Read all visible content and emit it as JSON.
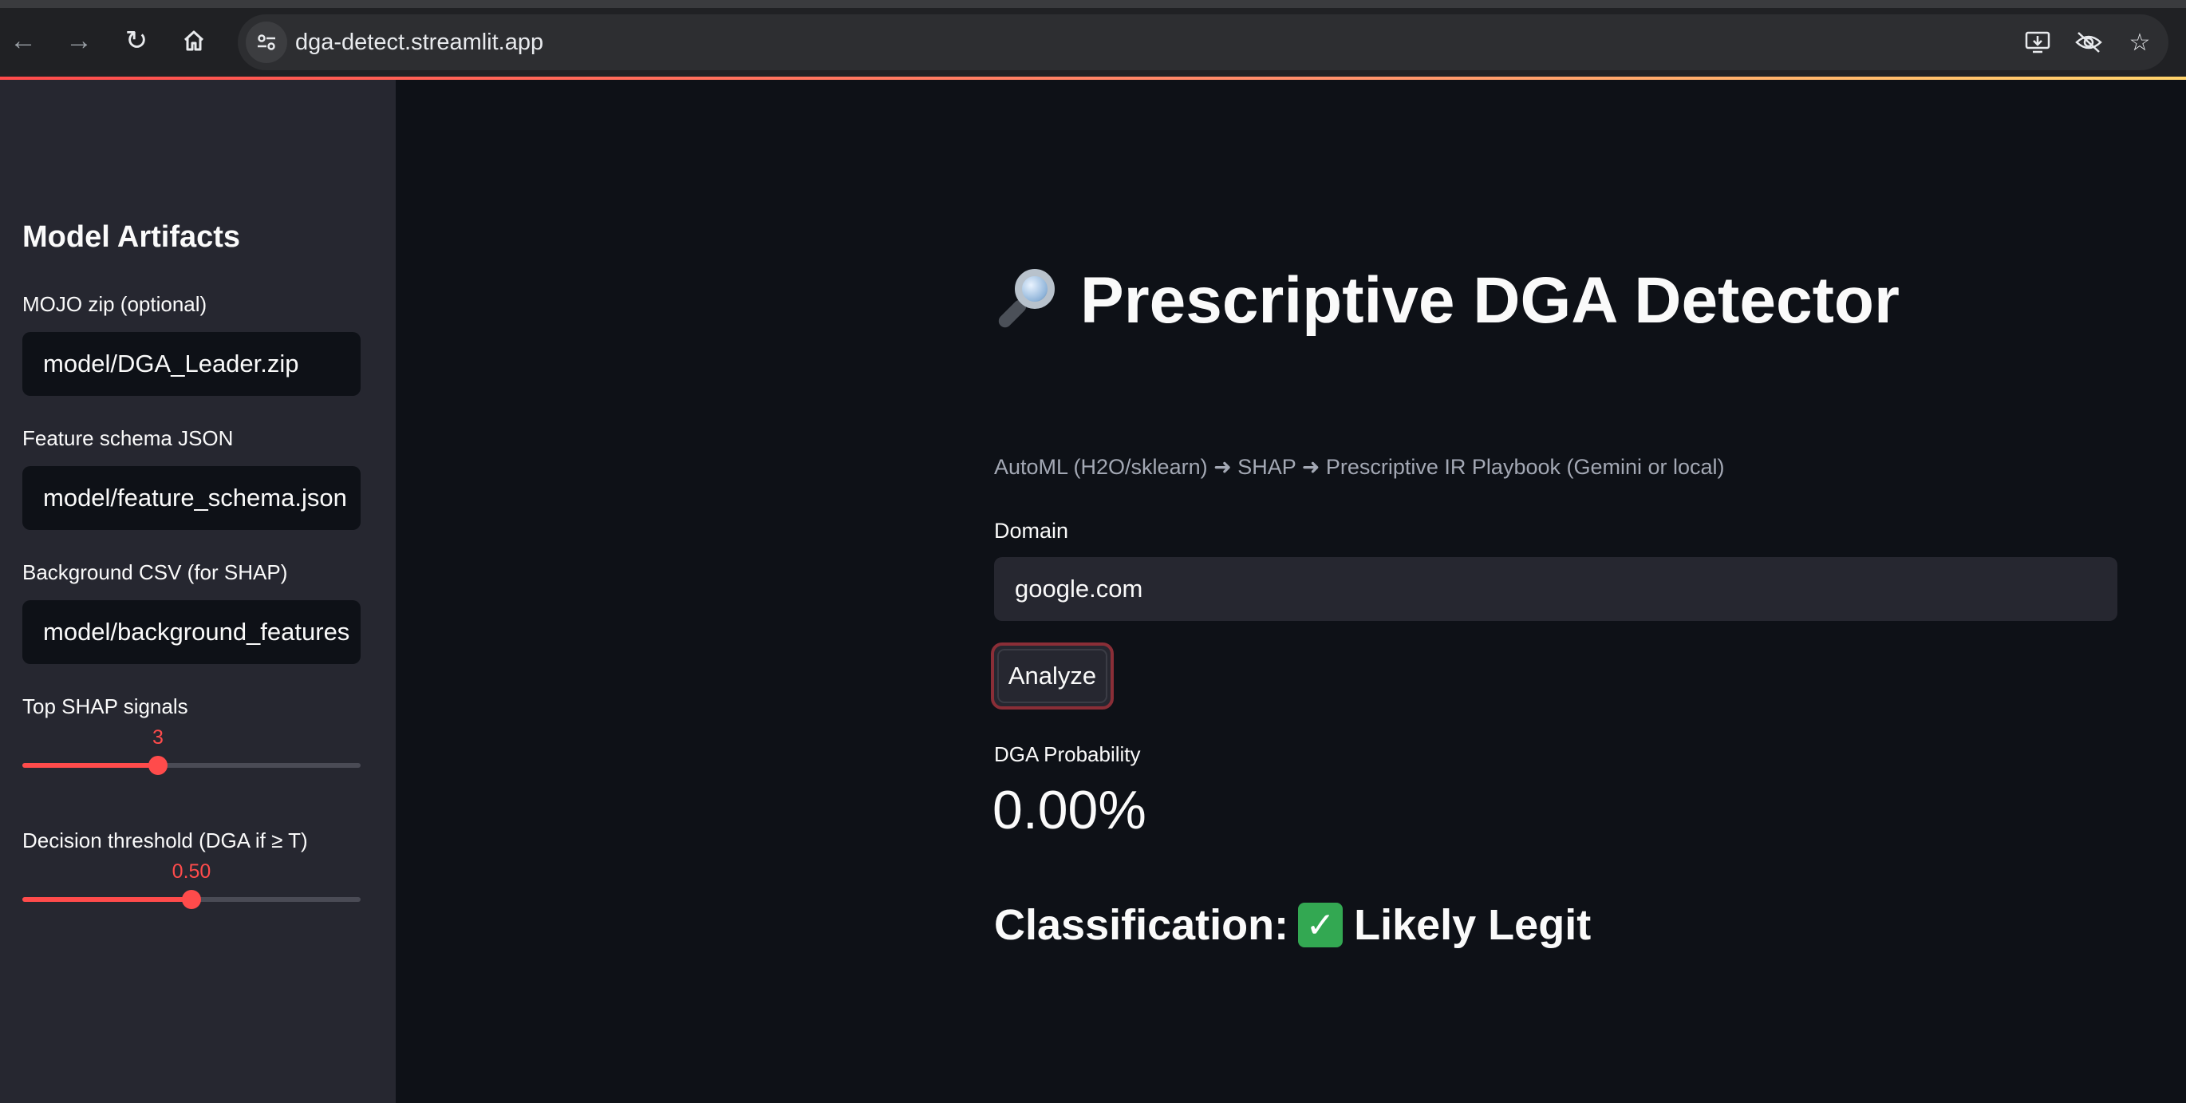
{
  "browser": {
    "url": "dga-detect.streamlit.app"
  },
  "sidebar": {
    "heading": "Model Artifacts",
    "mojo": {
      "label": "MOJO zip (optional)",
      "value": "model/DGA_Leader.zip"
    },
    "schema": {
      "label": "Feature schema JSON",
      "value": "model/feature_schema.json"
    },
    "background": {
      "label": "Background CSV (for SHAP)",
      "value": "model/background_features"
    },
    "top_shap": {
      "label": "Top SHAP signals",
      "value": "3",
      "fraction": 0.4
    },
    "threshold": {
      "label": "Decision threshold (DGA if ≥ T)",
      "value": "0.50",
      "fraction": 0.5
    }
  },
  "main": {
    "title": "Prescriptive DGA Detector",
    "title_icon": "magnifier-icon",
    "subtitle": "AutoML (H2O/sklearn) ➜ SHAP ➜ Prescriptive IR Playbook (Gemini or local)",
    "domain_label": "Domain",
    "domain_value": "google.com",
    "analyze_label": "Analyze",
    "metric_label": "DGA Probability",
    "metric_value": "0.00%",
    "classification_prefix": "Classification:",
    "classification_result": "Likely Legit",
    "classification_icon": "check-icon"
  },
  "colors": {
    "accent": "#ff4b4b",
    "background": "#0e1117",
    "sidebar": "#262730"
  }
}
